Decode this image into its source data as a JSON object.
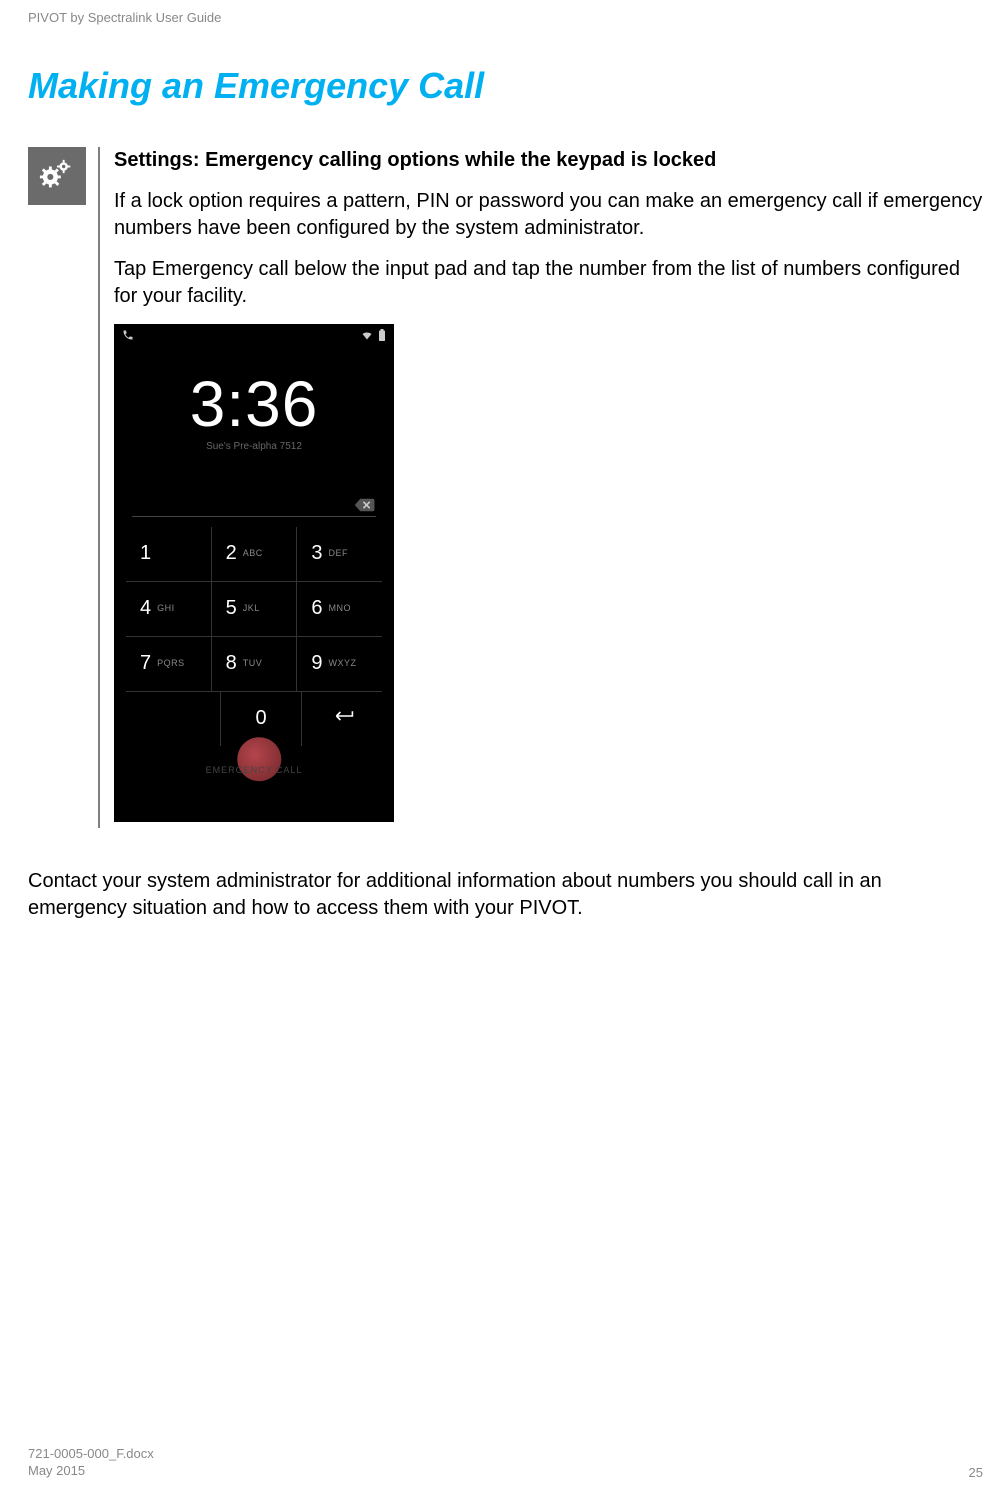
{
  "header": {
    "doc_title": "PIVOT by Spectralink User Guide"
  },
  "section": {
    "title": "Making an Emergency Call"
  },
  "callout": {
    "heading": "Settings: Emergency calling options while the keypad is locked",
    "para1": "If a lock option requires a pattern, PIN or password you can make an emergency call if emergency numbers have been configured by the system administrator.",
    "para2": "Tap Emergency call below the input pad and tap the number from the list of numbers configured for your facility."
  },
  "phone": {
    "time": "3:36",
    "subtitle": "Sue's Pre-alpha 7512",
    "keys": {
      "k1": "1",
      "k2": "2",
      "k2l": "ABC",
      "k3": "3",
      "k3l": "DEF",
      "k4": "4",
      "k4l": "GHI",
      "k5": "5",
      "k5l": "JKL",
      "k6": "6",
      "k6l": "MNO",
      "k7": "7",
      "k7l": "PQRS",
      "k8": "8",
      "k8l": "TUV",
      "k9": "9",
      "k9l": "WXYZ",
      "k0": "0"
    },
    "emergency_label": "EMERGENCY CALL"
  },
  "body": {
    "para": "Contact your system administrator for additional information about numbers you should call in an emergency situation and how to access them with your PIVOT."
  },
  "footer": {
    "filename": "721-0005-000_F.docx",
    "date": "May 2015",
    "page": "25"
  }
}
